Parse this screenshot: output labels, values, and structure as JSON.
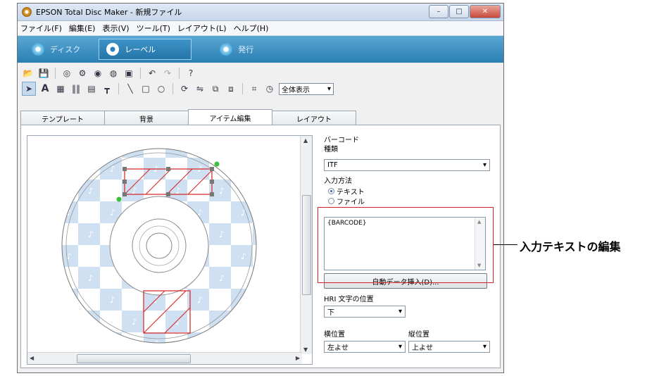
{
  "window": {
    "title": "EPSON Total Disc Maker - 新規ファイル",
    "controls": [
      "–",
      "□",
      "✕"
    ]
  },
  "menu": [
    "ファイル(F)",
    "編集(E)",
    "表示(V)",
    "ツール(T)",
    "レイアウト(L)",
    "ヘルプ(H)"
  ],
  "modes": [
    {
      "label": "ディスク"
    },
    {
      "label": "レーベル"
    },
    {
      "label": "発行"
    }
  ],
  "toolbar": {
    "zoom_value": "全体表示"
  },
  "tabs": [
    "テンプレート",
    "背景",
    "アイテム編集",
    "レイアウト"
  ],
  "props": {
    "section_title": "バーコード",
    "type_label": "種類",
    "type_value": "ITF",
    "input_method_label": "入力方法",
    "input_options": [
      "テキスト",
      "ファイル"
    ],
    "text_value": "{BARCODE}",
    "auto_insert_button": "自動データ挿入(D)...",
    "hri_label": "HRI 文字の位置",
    "hri_value": "下",
    "hpos_label": "横位置",
    "hpos_value": "左よせ",
    "vpos_label": "縦位置",
    "vpos_value": "上よせ"
  },
  "callout": "入力テキストの編集",
  "colors": {
    "accent_red": "#d62020",
    "mode_bar": "#2a7fb4"
  }
}
